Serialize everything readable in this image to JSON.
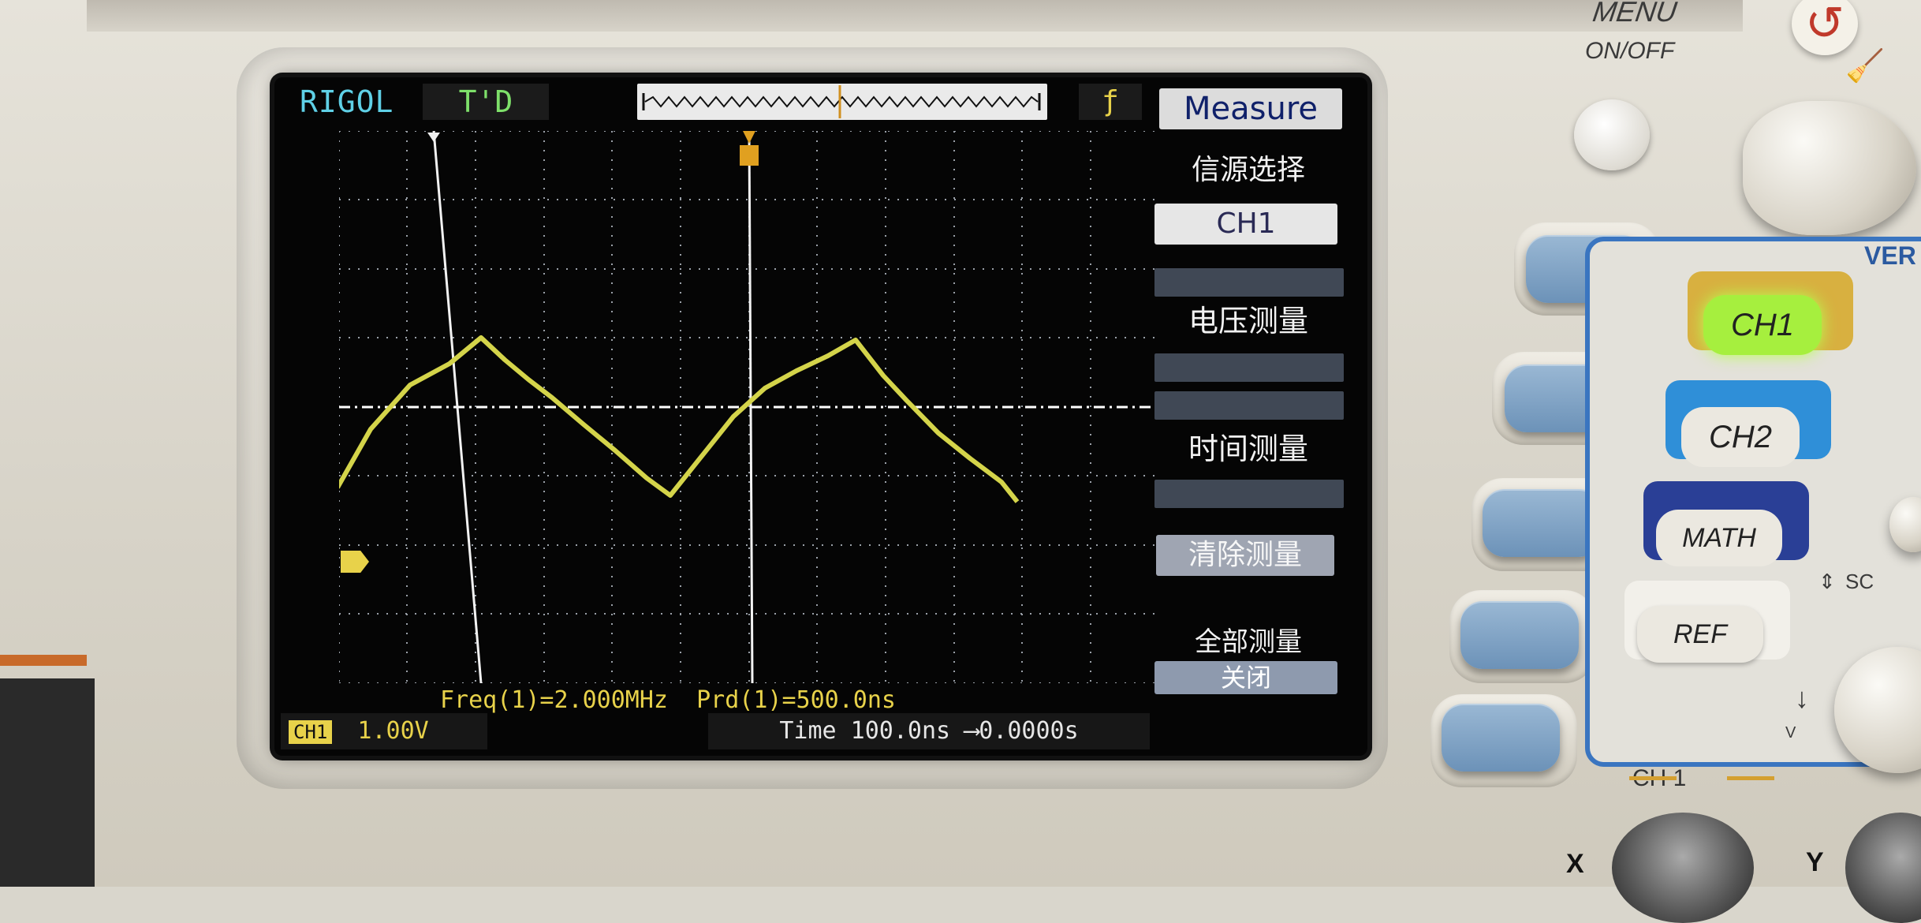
{
  "scope": {
    "brand": "RIGOL",
    "trigger_state": "T'D",
    "trigger_edge_icon": "rising-edge-icon",
    "menu": {
      "title": "Measure",
      "source_label": "信源选择",
      "source_value": "CH1",
      "voltage_label": "电压测量",
      "time_label": "时间测量",
      "clear_label": "清除测量",
      "all_label": "全部测量",
      "all_value": "关闭"
    },
    "measurements": "Freq(1)=2.000MHz  Prd(1)=500.0ns",
    "channel_badge": "CH1",
    "channel_scale": "1.00V",
    "timebase": "Time 100.0ns ",
    "trigger_offset": "⟶0.0000s",
    "trace_color": "#d4d44a",
    "waveform": {
      "type": "triangle",
      "frequency": "2.000MHz",
      "period": "500.0ns"
    }
  },
  "panel": {
    "menu_label": "MENU",
    "onoff_label": "ON/OFF",
    "vertical_label": "VER",
    "ch1_label": "CH1",
    "ch2_label": "CH2",
    "math_label": "MATH",
    "ref_label": "REF",
    "scale_label": "SC",
    "bottom_ch1_label": "CH 1",
    "x_label": "X",
    "y_label": "Y",
    "v_label": "V"
  }
}
